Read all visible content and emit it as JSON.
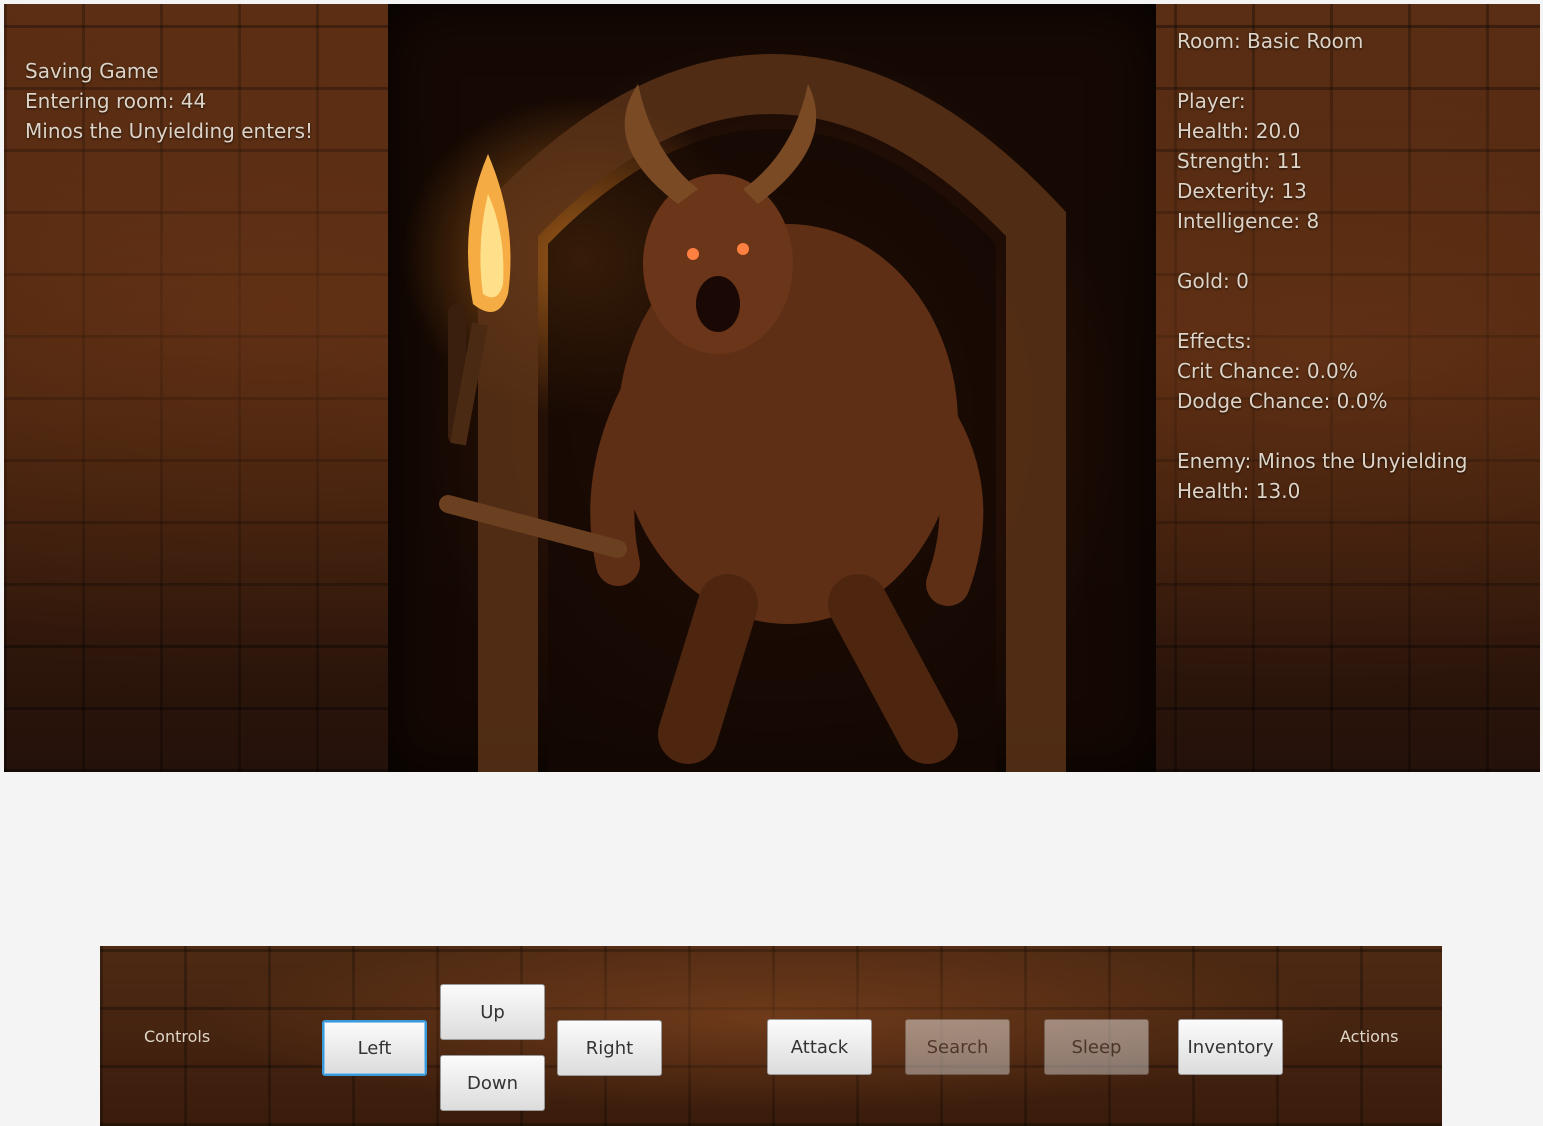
{
  "log": {
    "lines": [
      "Saving Game",
      "Entering room: 44",
      "Minos the Unyielding enters!"
    ]
  },
  "stats": {
    "room": "Room: Basic Room",
    "player_header": "Player:",
    "health": "Health: 20.0",
    "strength": "Strength: 11",
    "dexterity": "Dexterity: 13",
    "intelligence": "Intelligence: 8",
    "gold": "Gold: 0",
    "effects_header": "Effects:",
    "crit": "Crit Chance: 0.0%",
    "dodge": "Dodge Chance: 0.0%",
    "enemy": "Enemy: Minos the Unyielding",
    "enemy_health": "Health: 13.0"
  },
  "controls": {
    "label": "Controls",
    "left": "Left",
    "up": "Up",
    "down": "Down",
    "right": "Right"
  },
  "actions": {
    "label": "Actions",
    "attack": "Attack",
    "search": "Search",
    "sleep": "Sleep",
    "inventory": "Inventory"
  },
  "scene": {
    "depiction": "minotaur-with-torch-in-stone-doorway"
  }
}
